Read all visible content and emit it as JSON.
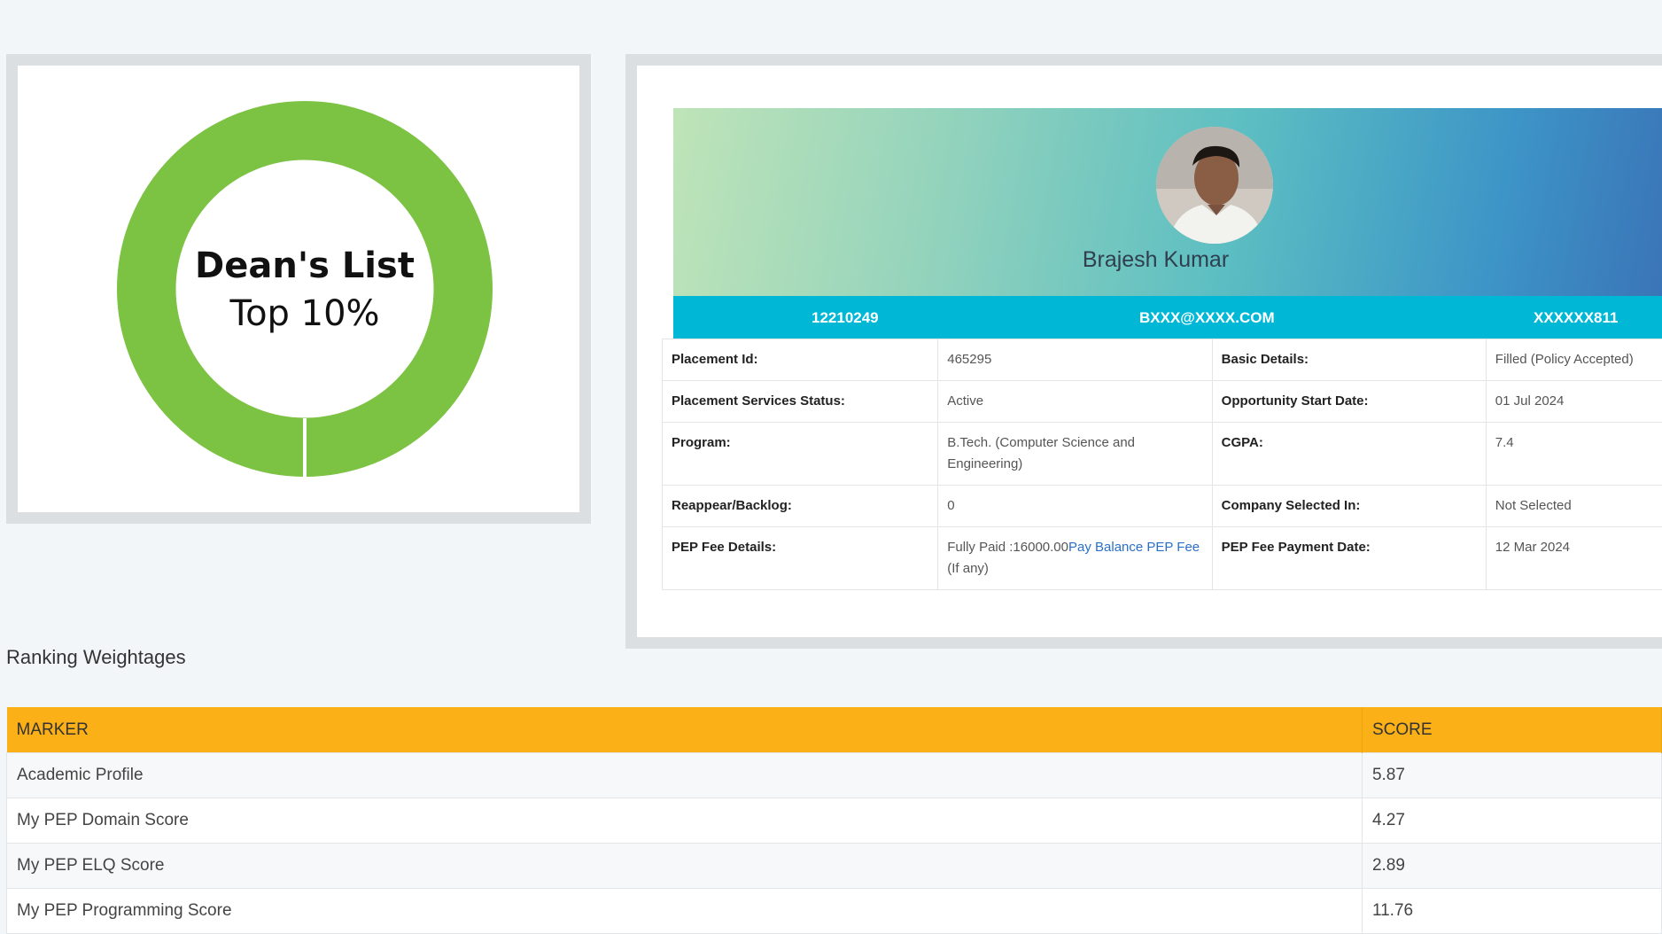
{
  "badge": {
    "title": "Dean's List",
    "subtitle": "Top 10%",
    "ring_color": "#7cc243"
  },
  "profile": {
    "name": "Brajesh Kumar",
    "registration_no": "12210249",
    "email": "BXXX@XXXX.COM",
    "phone": "XXXXXX811",
    "avatar_icon": "student-photo",
    "details": [
      {
        "label": "Placement Id:",
        "value": "465295",
        "label2": "Basic Details:",
        "value2": "Filled (Policy Accepted)"
      },
      {
        "label": "Placement Services Status:",
        "value": "Active",
        "label2": "Opportunity Start Date:",
        "value2": "01 Jul 2024"
      },
      {
        "label": "Program:",
        "value": "B.Tech. (Computer Science and Engineering)",
        "label2": "CGPA:",
        "value2": "7.4"
      },
      {
        "label": "Reappear/Backlog:",
        "value": "0",
        "label2": "Company Selected In:",
        "value2": "Not Selected"
      },
      {
        "label": "PEP Fee Details:",
        "value_prefix": "Fully Paid :16000.00",
        "value_link": "Pay Balance PEP Fee",
        "value_suffix": " (If any)",
        "label2": "PEP Fee Payment Date:",
        "value2": "12 Mar 2024"
      }
    ]
  },
  "ranking": {
    "heading": "Ranking Weightages",
    "header_color": "#fbb017",
    "columns": [
      "MARKER",
      "SCORE"
    ],
    "rows": [
      {
        "marker": "Academic Profile",
        "score": "5.87"
      },
      {
        "marker": "My PEP Domain Score",
        "score": "4.27"
      },
      {
        "marker": "My PEP ELQ Score",
        "score": "2.89"
      },
      {
        "marker": "My PEP Programming Score",
        "score": "11.76"
      }
    ]
  }
}
